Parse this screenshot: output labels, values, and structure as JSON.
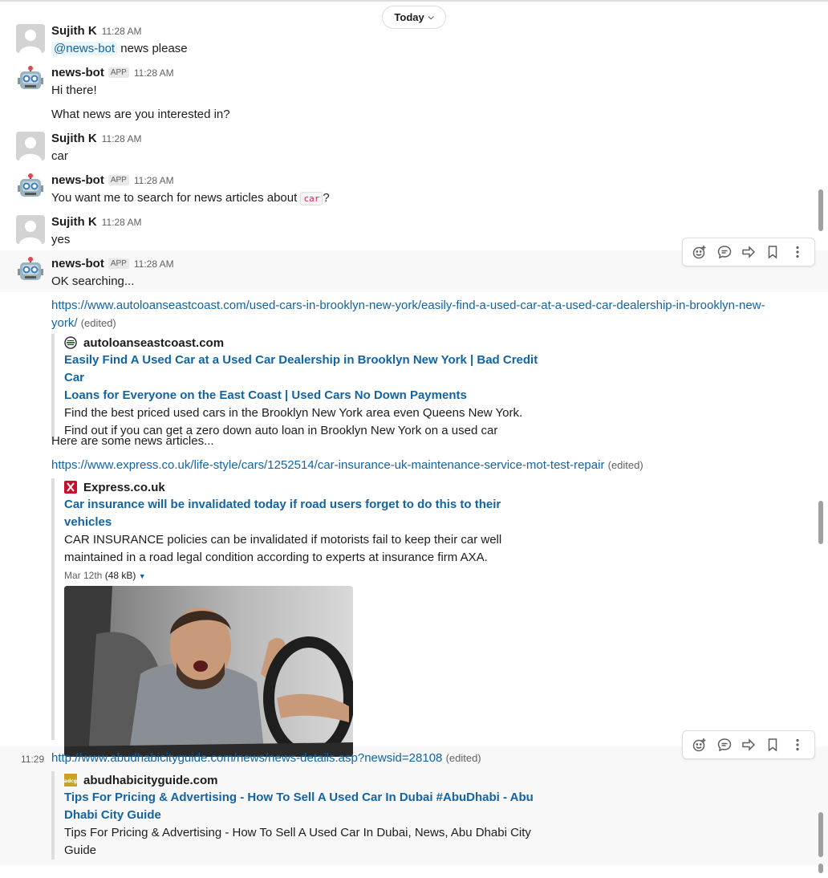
{
  "day_label": "Today",
  "messages": [
    {
      "author": "Sujith K",
      "time": "11:28 AM",
      "mention": "@news-bot",
      "text": "news please"
    },
    {
      "author": "news-bot",
      "badge": "APP",
      "time": "11:28 AM",
      "lines": [
        "Hi there!",
        "What news are you interested in?"
      ]
    },
    {
      "author": "Sujith K",
      "time": "11:28 AM",
      "text": "car"
    },
    {
      "author": "news-bot",
      "badge": "APP",
      "time": "11:28 AM",
      "text_before": "You want me to search for news articles about ",
      "code": "car",
      "text_after": "?"
    },
    {
      "author": "Sujith K",
      "time": "11:28 AM",
      "text": "yes"
    },
    {
      "author": "news-bot",
      "badge": "APP",
      "time": "11:28 AM",
      "text": "OK searching..."
    }
  ],
  "link1": {
    "url_line1": "https://www.autoloanseastcoast.com/used-cars-in-brooklyn-new-york/easily-find-a-used-car-at-a-used-car-dealership-in-brooklyn-new-",
    "url_line2": "york/",
    "edited": "(edited)",
    "site": "autoloanseastcoast.com",
    "title_line1": "Easily Find A Used Car at a Used Car Dealership in Brooklyn New York | Bad Credit Car",
    "title_line2": "Loans for Everyone on the East Coast | Used Cars No Down Payments",
    "desc_line1": "Find the best priced used cars in the Brooklyn New York area even Queens New York.",
    "desc_line2": "Find out if you can get a zero down auto loan in Brooklyn New York on a used car"
  },
  "here_text": "Here are some news articles...",
  "link2": {
    "url": "https://www.express.co.uk/life-style/cars/1252514/car-insurance-uk-maintenance-service-mot-test-repair",
    "edited": "(edited)",
    "site": "Express.co.uk",
    "title": "Car insurance will be invalidated today if road users forget to do this to their vehicles",
    "desc_line1": "CAR INSURANCE policies can be invalidated if motorists fail to keep their car well",
    "desc_line2": "maintained in a road legal condition according to experts at insurance firm AXA.",
    "date": "Mar 12th",
    "size": "(48 kB)"
  },
  "link3": {
    "time": "11:29",
    "url": "http://www.abudhabicityguide.com/news/news-details.asp?newsid=28108",
    "edited": "(edited)",
    "site": "abudhabicityguide.com",
    "favicon_text": "adcg",
    "title_line1": "Tips For Pricing & Advertising - How To Sell A Used Car In Dubai #AbuDhabi - Abu",
    "title_line2": "Dhabi City Guide",
    "desc_line1": "Tips For Pricing & Advertising - How To Sell A Used Car In Dubai, News, Abu Dhabi City",
    "desc_line2": "Guide"
  },
  "icons": {
    "reaction": "add-reaction-icon",
    "thread": "reply-thread-icon",
    "share": "share-icon",
    "save": "bookmark-icon",
    "more": "more-actions-icon"
  },
  "colors": {
    "link": "#1264a3",
    "code": "#e01e5a",
    "hover_bg": "#f8f8f8"
  }
}
